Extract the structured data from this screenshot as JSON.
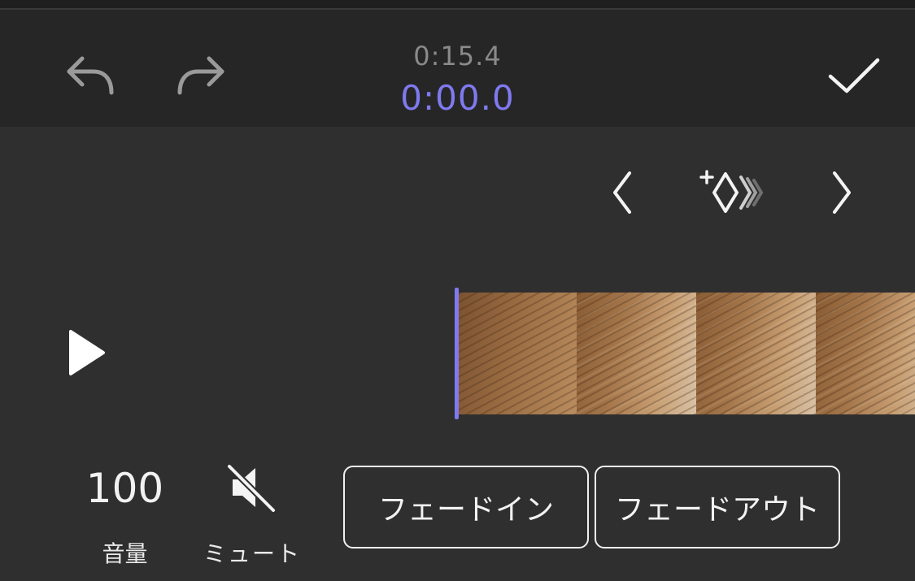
{
  "header": {
    "total_time": "0:15.4",
    "current_time": "0:00.0",
    "undo_icon": "undo-arrow-icon",
    "redo_icon": "redo-arrow-icon",
    "done_icon": "checkmark-icon"
  },
  "keyframes": {
    "prev_icon": "chevron-left-icon",
    "add_icon": "add-keyframe-icon",
    "next_icon": "chevron-right-icon"
  },
  "timeline": {
    "play_icon": "play-icon",
    "frame_count": 4
  },
  "controls": {
    "volume_value": "100",
    "volume_label": "音量",
    "mute_label": "ミュート",
    "mute_icon": "speaker-muted-icon",
    "fade_in_label": "フェードイン",
    "fade_out_label": "フェードアウト"
  },
  "colors": {
    "accent": "#7f7af0",
    "header_bg": "#262626",
    "body_bg": "#2f2f2f",
    "text": "#f2f2f2",
    "muted_text": "#8a8a8a"
  }
}
